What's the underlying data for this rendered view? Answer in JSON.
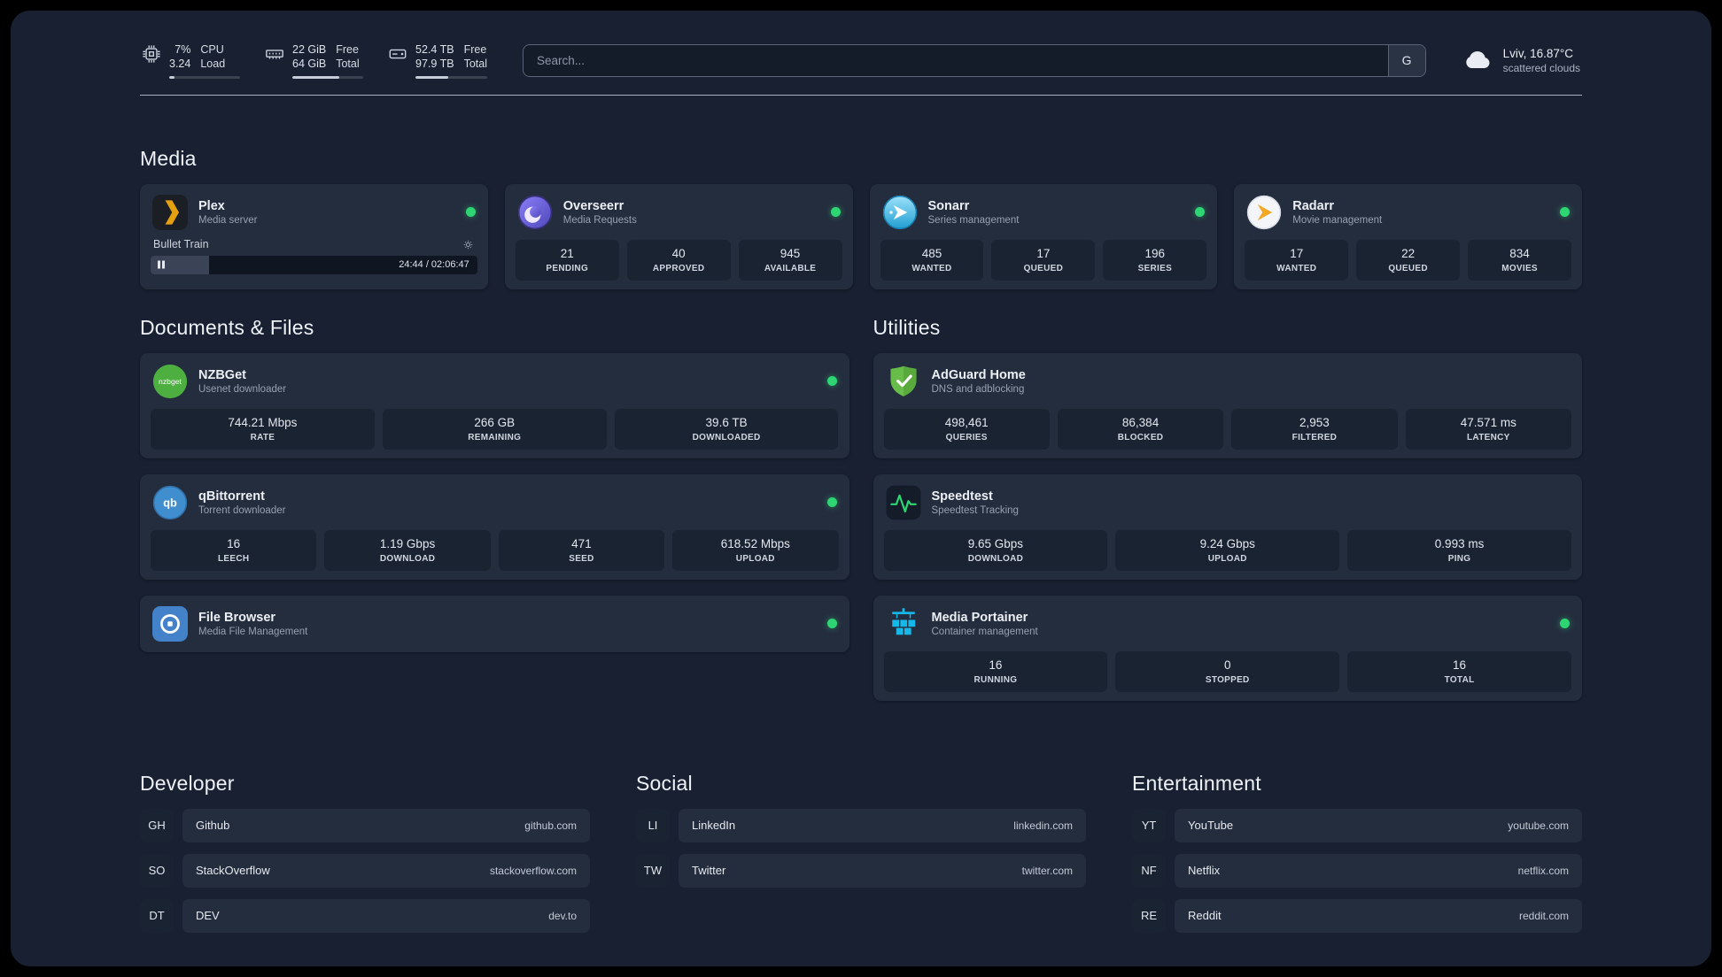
{
  "topbar": {
    "cpu": {
      "line1": "7%",
      "line2": "3.24",
      "label1": "CPU",
      "label2": "Load",
      "progress": 7
    },
    "memory": {
      "line1": "22 GiB",
      "line2": "64 GiB",
      "label1": "Free",
      "label2": "Total",
      "progress": 66
    },
    "disk": {
      "line1": "52.4 TB",
      "line2": "97.9 TB",
      "label1": "Free",
      "label2": "Total",
      "progress": 46
    },
    "search": {
      "placeholder": "Search...",
      "button_label": "G"
    },
    "weather": {
      "location": "Lviv, 16.87°C",
      "condition": "scattered clouds"
    }
  },
  "sections": {
    "media": {
      "title": "Media"
    },
    "documents": {
      "title": "Documents & Files"
    },
    "utilities": {
      "title": "Utilities"
    },
    "developer": {
      "title": "Developer"
    },
    "social": {
      "title": "Social"
    },
    "entertainment": {
      "title": "Entertainment"
    }
  },
  "media": {
    "plex": {
      "name": "Plex",
      "subtitle": "Media server",
      "now_playing": "Bullet Train",
      "time": "24:44 / 02:06:47",
      "progress": 18
    },
    "overseerr": {
      "name": "Overseerr",
      "subtitle": "Media Requests",
      "stats": [
        {
          "value": "21",
          "label": "PENDING"
        },
        {
          "value": "40",
          "label": "APPROVED"
        },
        {
          "value": "945",
          "label": "AVAILABLE"
        }
      ]
    },
    "sonarr": {
      "name": "Sonarr",
      "subtitle": "Series management",
      "stats": [
        {
          "value": "485",
          "label": "WANTED"
        },
        {
          "value": "17",
          "label": "QUEUED"
        },
        {
          "value": "196",
          "label": "SERIES"
        }
      ]
    },
    "radarr": {
      "name": "Radarr",
      "subtitle": "Movie management",
      "stats": [
        {
          "value": "17",
          "label": "WANTED"
        },
        {
          "value": "22",
          "label": "QUEUED"
        },
        {
          "value": "834",
          "label": "MOVIES"
        }
      ]
    }
  },
  "documents": {
    "nzbget": {
      "name": "NZBGet",
      "subtitle": "Usenet downloader",
      "stats": [
        {
          "value": "744.21 Mbps",
          "label": "RATE"
        },
        {
          "value": "266 GB",
          "label": "REMAINING"
        },
        {
          "value": "39.6 TB",
          "label": "DOWNLOADED"
        }
      ]
    },
    "qbittorrent": {
      "name": "qBittorrent",
      "subtitle": "Torrent downloader",
      "stats": [
        {
          "value": "16",
          "label": "LEECH"
        },
        {
          "value": "1.19 Gbps",
          "label": "DOWNLOAD"
        },
        {
          "value": "471",
          "label": "SEED"
        },
        {
          "value": "618.52 Mbps",
          "label": "UPLOAD"
        }
      ]
    },
    "filebrowser": {
      "name": "File Browser",
      "subtitle": "Media File Management"
    }
  },
  "utilities": {
    "adguard": {
      "name": "AdGuard Home",
      "subtitle": "DNS and adblocking",
      "stats": [
        {
          "value": "498,461",
          "label": "QUERIES"
        },
        {
          "value": "86,384",
          "label": "BLOCKED"
        },
        {
          "value": "2,953",
          "label": "FILTERED"
        },
        {
          "value": "47.571 ms",
          "label": "LATENCY"
        }
      ]
    },
    "speedtest": {
      "name": "Speedtest",
      "subtitle": "Speedtest Tracking",
      "stats": [
        {
          "value": "9.65 Gbps",
          "label": "DOWNLOAD"
        },
        {
          "value": "9.24 Gbps",
          "label": "UPLOAD"
        },
        {
          "value": "0.993 ms",
          "label": "PING"
        }
      ]
    },
    "portainer": {
      "name": "Media Portainer",
      "subtitle": "Container management",
      "stats": [
        {
          "value": "16",
          "label": "RUNNING"
        },
        {
          "value": "0",
          "label": "STOPPED"
        },
        {
          "value": "16",
          "label": "TOTAL"
        }
      ]
    }
  },
  "bookmarks": {
    "developer": [
      {
        "abbr": "GH",
        "name": "Github",
        "domain": "github.com"
      },
      {
        "abbr": "SO",
        "name": "StackOverflow",
        "domain": "stackoverflow.com"
      },
      {
        "abbr": "DT",
        "name": "DEV",
        "domain": "dev.to"
      }
    ],
    "social": [
      {
        "abbr": "LI",
        "name": "LinkedIn",
        "domain": "linkedin.com"
      },
      {
        "abbr": "TW",
        "name": "Twitter",
        "domain": "twitter.com"
      }
    ],
    "entertainment": [
      {
        "abbr": "YT",
        "name": "YouTube",
        "domain": "youtube.com"
      },
      {
        "abbr": "NF",
        "name": "Netflix",
        "domain": "netflix.com"
      },
      {
        "abbr": "RE",
        "name": "Reddit",
        "domain": "reddit.com"
      }
    ]
  },
  "icons": {
    "nzbget_text": "nzbget",
    "qbittorrent_text": "qb"
  },
  "colors": {
    "background": "#182032",
    "card": "#242d3e",
    "tile": "#1a2332",
    "status_online": "#2ed573",
    "plex_amber": "#e5a00d",
    "overseerr_purple": "#6a5cf0",
    "sonarr_blue": "#2d9fd8",
    "radarr_amber": "#f5a623",
    "nzbget_green": "#4caf3f",
    "qbittorrent_blue": "#418ecf",
    "filebrowser_blue": "#4382c8",
    "adguard_green": "#68bc49",
    "speedtest_green": "#2bd875",
    "portainer_blue": "#16b8ea"
  }
}
